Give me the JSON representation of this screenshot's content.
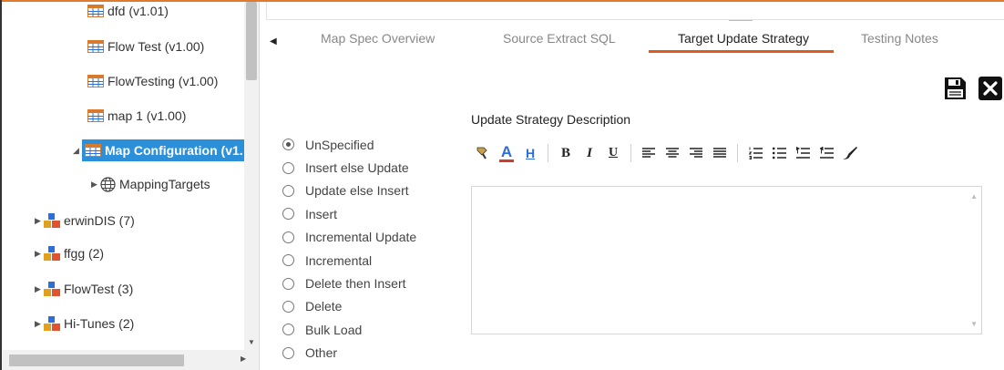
{
  "tree": {
    "items": [
      {
        "label": "dfd (v1.01)",
        "type": "table"
      },
      {
        "label": "Flow Test (v1.00)",
        "type": "table"
      },
      {
        "label": "FlowTesting (v1.00)",
        "type": "table"
      },
      {
        "label": "map 1 (v1.00)",
        "type": "table"
      },
      {
        "label": "Map Configuration (v1.",
        "type": "table",
        "selected": true
      },
      {
        "label": "MappingTargets",
        "type": "globe"
      },
      {
        "label": "erwinDIS (7)",
        "type": "datasource"
      },
      {
        "label": "ffgg (2)",
        "type": "datasource"
      },
      {
        "label": "FlowTest (3)",
        "type": "datasource"
      },
      {
        "label": "Hi-Tunes (2)",
        "type": "datasource"
      }
    ]
  },
  "tabs": [
    {
      "label": "Map Spec Overview",
      "active": false
    },
    {
      "label": "Source Extract SQL",
      "active": false
    },
    {
      "label": "Target Update Strategy",
      "active": true
    },
    {
      "label": "Testing Notes",
      "active": false
    }
  ],
  "actions": {
    "save_icon": "save-icon",
    "close_icon": "close-icon"
  },
  "strategy": {
    "description_label": "Update Strategy Description",
    "selected": "UnSpecified",
    "options": [
      "UnSpecified",
      "Insert else Update",
      "Update else Insert",
      "Insert",
      "Incremental Update",
      "Incremental",
      "Delete then Insert",
      "Delete",
      "Bulk Load",
      "Other"
    ],
    "description_value": ""
  },
  "editor_toolbar": {
    "groups": [
      [
        "paint-format-icon",
        "font-color-icon",
        "highlight-icon"
      ],
      [
        "bold-icon",
        "italic-icon",
        "underline-icon"
      ],
      [
        "align-left-icon",
        "align-center-icon",
        "align-right-icon",
        "justify-icon"
      ],
      [
        "ordered-list-icon",
        "unordered-list-icon",
        "indent-icon",
        "outdent-icon",
        "clear-format-icon"
      ]
    ],
    "font_color_letter": "A",
    "highlight_letter": "H",
    "bold_letter": "B",
    "italic_letter": "I",
    "underline_letter": "U"
  },
  "colors": {
    "accent": "#e05a1e",
    "selection": "#2c8fd9",
    "table_icon": "#d9792c",
    "font_color_bar": "#d33a2c",
    "highlight_letter": "#2c6fd9"
  }
}
